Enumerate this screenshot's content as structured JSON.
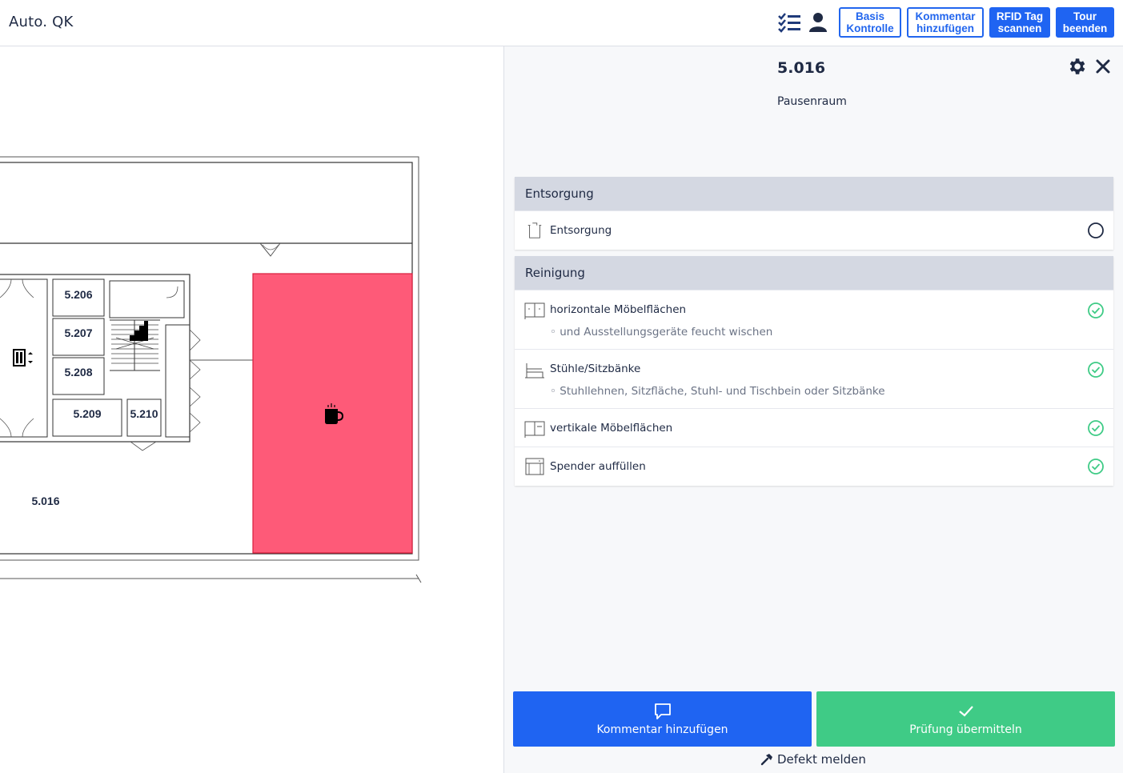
{
  "app": {
    "title": "Auto. QK"
  },
  "toolbar": {
    "icons": [
      "checklist-icon",
      "user-icon"
    ],
    "buttons": [
      {
        "line1": "Basis",
        "line2": "Kontrolle",
        "style": "outline"
      },
      {
        "line1": "Kommentar",
        "line2": "hinzufügen",
        "style": "outline"
      },
      {
        "line1": "RFID Tag",
        "line2": "scannen",
        "style": "solid"
      },
      {
        "line1": "Tour",
        "line2": "beenden",
        "style": "solid"
      }
    ]
  },
  "floorplan": {
    "rooms": [
      "5.206",
      "5.207",
      "5.208",
      "5.209",
      "5.210"
    ],
    "current_room_label": "5.016",
    "selected_fill": "#fe5a78",
    "room_icon": "coffee-cup-icon"
  },
  "panel": {
    "room_number": "5.016",
    "room_name": "Pausenraum",
    "sections": [
      {
        "title": "Entsorgung",
        "tasks": [
          {
            "label": "Entsorgung",
            "sub": "",
            "icon": "bin-icon",
            "status": "open"
          }
        ]
      },
      {
        "title": "Reinigung",
        "tasks": [
          {
            "label": "horizontale Möbelflächen",
            "sub": "◦ und Ausstellungsgeräte feucht wischen",
            "icon": "cabinet-icon",
            "status": "done"
          },
          {
            "label": "Stühle/Sitzbänke",
            "sub": "◦ Stuhllehnen, Sitzfläche, Stuhl- und Tischbein oder Sitzbänke",
            "icon": "bench-icon",
            "status": "done"
          },
          {
            "label": "vertikale Möbelflächen",
            "sub": "",
            "icon": "cabinet-icon",
            "status": "done"
          },
          {
            "label": "Spender auffüllen",
            "sub": "",
            "icon": "dispenser-icon",
            "status": "done"
          }
        ]
      }
    ],
    "actions": {
      "comment_label": "Kommentar hinzufügen",
      "submit_label": "Prüfung übermitteln",
      "defect_label": "Defekt melden"
    }
  },
  "colors": {
    "primary": "#1f64f2",
    "success": "#3fcb86",
    "text": "#1f2a44",
    "section_header": "#d4d8e2"
  }
}
